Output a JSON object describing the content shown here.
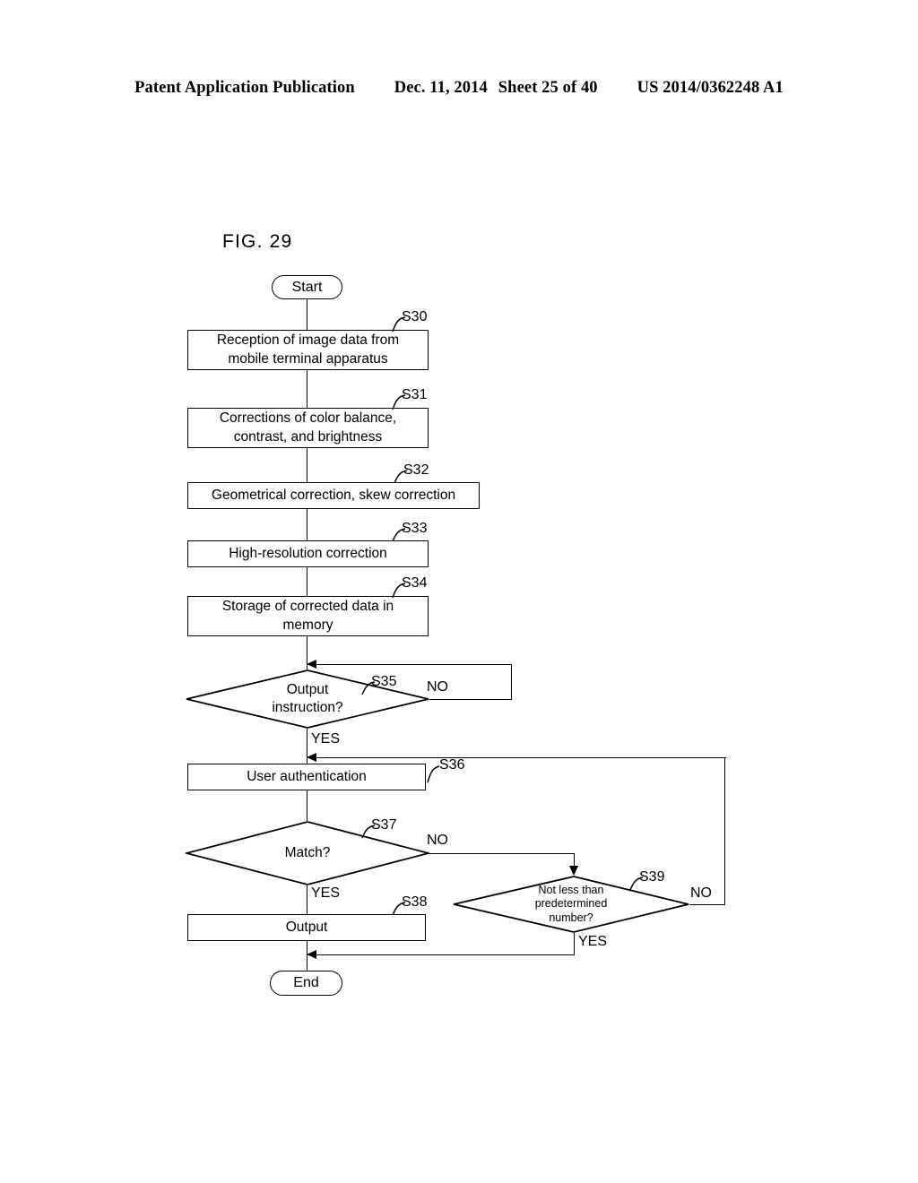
{
  "header": {
    "publication": "Patent Application Publication",
    "date": "Dec. 11, 2014",
    "sheet": "Sheet 25 of 40",
    "patent_number": "US 2014/0362248 A1"
  },
  "figure": {
    "label": "FIG. 29",
    "start_label": "Start",
    "end_label": "End",
    "steps": [
      {
        "tag": "S30",
        "text": "Reception of image data from\nmobile terminal apparatus",
        "type": "process"
      },
      {
        "tag": "S31",
        "text": "Corrections of color balance,\ncontrast, and brightness",
        "type": "process"
      },
      {
        "tag": "S32",
        "text": "Geometrical correction, skew correction",
        "type": "process"
      },
      {
        "tag": "S33",
        "text": "High-resolution correction",
        "type": "process"
      },
      {
        "tag": "S34",
        "text": "Storage of corrected data in\nmemory",
        "type": "process"
      },
      {
        "tag": "S35",
        "text": "Output\ninstruction?",
        "type": "decision"
      },
      {
        "tag": "S36",
        "text": "User authentication",
        "type": "process"
      },
      {
        "tag": "S37",
        "text": "Match?",
        "type": "decision"
      },
      {
        "tag": "S38",
        "text": "Output",
        "type": "process"
      },
      {
        "tag": "S39",
        "text": "Not less than\npredetermined\nnumber?",
        "type": "decision"
      }
    ],
    "branch_labels": {
      "s35_no": "NO",
      "s35_yes": "YES",
      "s37_no": "NO",
      "s37_yes": "YES",
      "s39_no": "NO",
      "s39_yes": "YES"
    }
  }
}
